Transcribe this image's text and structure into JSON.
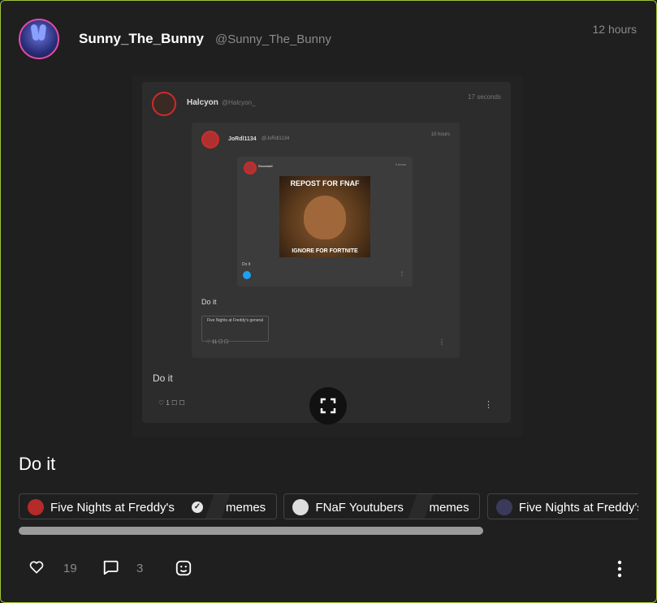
{
  "post": {
    "username": "Sunny_The_Bunny",
    "handle": "@Sunny_The_Bunny",
    "time": "12 hours",
    "text": "Do it",
    "likes": "19",
    "comments": "3"
  },
  "embed": {
    "level1": {
      "name": "Halcyon",
      "handle": "@Halcyon_",
      "time": "17 seconds",
      "text": "Do it",
      "likes": "1"
    },
    "level2": {
      "name": "JoRdl1134",
      "handle": "@JoRdl1134",
      "time": "19 hours",
      "text": "Do it",
      "tag": "Five Nights at Freddy's  general",
      "likes": "11"
    },
    "level3": {
      "name": "Snowball",
      "time": "4 hours",
      "meme_top": "REPOST FOR FNAF",
      "meme_bottom": "IGNORE FOR FORTNITE",
      "text": "Do it"
    }
  },
  "tags": [
    {
      "community": "Five Nights at Freddy's",
      "verified": true,
      "sub": "memes",
      "color": "#b52a2a"
    },
    {
      "community": "FNaF Youtubers",
      "verified": false,
      "sub": "memes",
      "color": "#dddddd"
    },
    {
      "community": "Five Nights at Freddy's",
      "verified": false,
      "sub": "",
      "color": "#3a3a5a"
    }
  ],
  "colors": {
    "card_border": "#9ec43a",
    "avatar_ring": "#e64aa8",
    "background": "#1f1f1f"
  }
}
